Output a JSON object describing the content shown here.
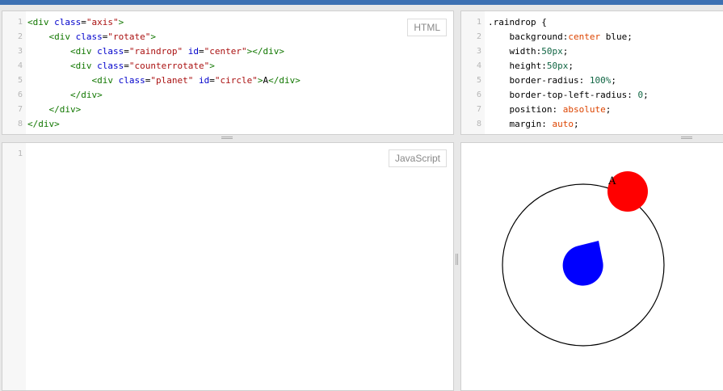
{
  "editors": {
    "html": {
      "badge": "HTML",
      "lines": [
        {
          "n": "1",
          "indent": "",
          "tokens": [
            [
              "tag",
              "<div "
            ],
            [
              "attr",
              "class"
            ],
            [
              "plain",
              "="
            ],
            [
              "str",
              "\"axis\""
            ],
            [
              "tag",
              ">"
            ]
          ]
        },
        {
          "n": "2",
          "indent": "    ",
          "tokens": [
            [
              "tag",
              "<div "
            ],
            [
              "attr",
              "class"
            ],
            [
              "plain",
              "="
            ],
            [
              "str",
              "\"rotate\""
            ],
            [
              "tag",
              ">"
            ]
          ]
        },
        {
          "n": "3",
          "indent": "        ",
          "tokens": [
            [
              "tag",
              "<div "
            ],
            [
              "attr",
              "class"
            ],
            [
              "plain",
              "="
            ],
            [
              "str",
              "\"raindrop\""
            ],
            [
              "plain",
              " "
            ],
            [
              "attr",
              "id"
            ],
            [
              "plain",
              "="
            ],
            [
              "str",
              "\"center\""
            ],
            [
              "tag",
              "></div>"
            ]
          ]
        },
        {
          "n": "4",
          "indent": "        ",
          "tokens": [
            [
              "tag",
              "<div "
            ],
            [
              "attr",
              "class"
            ],
            [
              "plain",
              "="
            ],
            [
              "str",
              "\"counterrotate\""
            ],
            [
              "tag",
              ">"
            ]
          ]
        },
        {
          "n": "5",
          "indent": "            ",
          "tokens": [
            [
              "tag",
              "<div "
            ],
            [
              "attr",
              "class"
            ],
            [
              "plain",
              "="
            ],
            [
              "str",
              "\"planet\""
            ],
            [
              "plain",
              " "
            ],
            [
              "attr",
              "id"
            ],
            [
              "plain",
              "="
            ],
            [
              "str",
              "\"circle\""
            ],
            [
              "tag",
              ">"
            ],
            [
              "plain",
              "A"
            ],
            [
              "tag",
              "</div>"
            ]
          ]
        },
        {
          "n": "6",
          "indent": "        ",
          "tokens": [
            [
              "tag",
              "</div>"
            ]
          ]
        },
        {
          "n": "7",
          "indent": "    ",
          "tokens": [
            [
              "tag",
              "</div>"
            ]
          ]
        },
        {
          "n": "8",
          "indent": "",
          "tokens": [
            [
              "tag",
              "</div>"
            ]
          ]
        }
      ]
    },
    "css": {
      "lines": [
        {
          "n": "1",
          "indent": "",
          "tokens": [
            [
              "plain",
              ".raindrop {"
            ]
          ]
        },
        {
          "n": "2",
          "indent": "    ",
          "tokens": [
            [
              "prop",
              "background:"
            ],
            [
              "val",
              "center"
            ],
            [
              "plain",
              " blue;"
            ]
          ]
        },
        {
          "n": "3",
          "indent": "    ",
          "tokens": [
            [
              "prop",
              "width:"
            ],
            [
              "num",
              "50px"
            ],
            [
              "plain",
              ";"
            ]
          ]
        },
        {
          "n": "4",
          "indent": "    ",
          "tokens": [
            [
              "prop",
              "height:"
            ],
            [
              "num",
              "50px"
            ],
            [
              "plain",
              ";"
            ]
          ]
        },
        {
          "n": "5",
          "indent": "    ",
          "tokens": [
            [
              "prop",
              "border-radius: "
            ],
            [
              "num",
              "100%"
            ],
            [
              "plain",
              ";"
            ]
          ]
        },
        {
          "n": "6",
          "indent": "    ",
          "tokens": [
            [
              "prop",
              "border-top-left-radius: "
            ],
            [
              "num",
              "0"
            ],
            [
              "plain",
              ";"
            ]
          ]
        },
        {
          "n": "7",
          "indent": "    ",
          "tokens": [
            [
              "prop",
              "position: "
            ],
            [
              "val",
              "absolute"
            ],
            [
              "plain",
              ";"
            ]
          ]
        },
        {
          "n": "8",
          "indent": "    ",
          "tokens": [
            [
              "prop",
              "margin: "
            ],
            [
              "val",
              "auto"
            ],
            [
              "plain",
              ";"
            ]
          ]
        }
      ]
    },
    "js": {
      "badge": "JavaScript",
      "lines": [
        {
          "n": "1",
          "indent": "",
          "tokens": []
        }
      ]
    }
  },
  "result": {
    "planet_label": "A",
    "orbit_color": "#000000",
    "raindrop_color": "#0000ff",
    "planet_color": "#ff0000"
  },
  "colors": {
    "topbar": "#3d71b3"
  }
}
